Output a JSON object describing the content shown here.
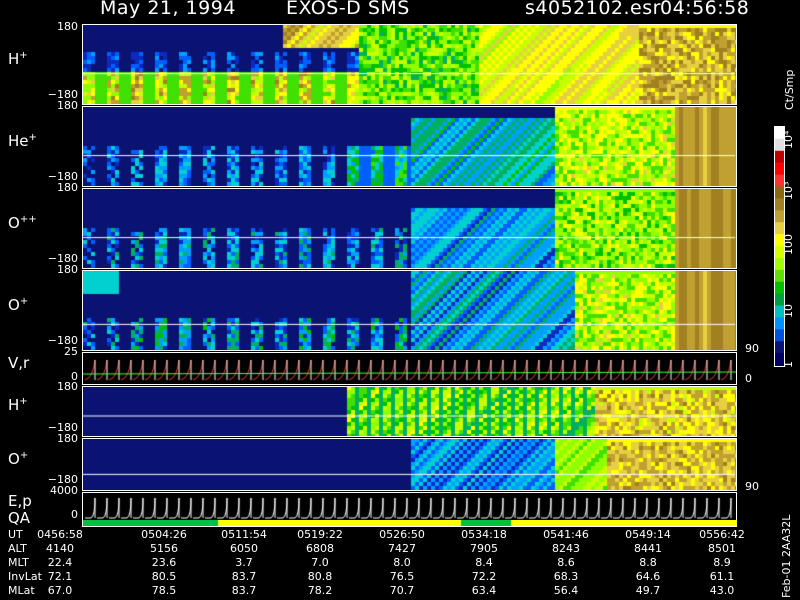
{
  "header": {
    "date": "May 21, 1994",
    "instrument": "EXOS-D SMS",
    "file": "s4052102.esr",
    "time": "04:56:58"
  },
  "panels": [
    {
      "id": "H+",
      "label": "H",
      "sup": "+",
      "ytop": "180",
      "ybot": "−180"
    },
    {
      "id": "He+",
      "label": "He",
      "sup": "+",
      "ytop": "180",
      "ybot": "−180"
    },
    {
      "id": "O++",
      "label": "O",
      "sup": "++",
      "ytop": "180",
      "ybot": "−180"
    },
    {
      "id": "O+",
      "label": "O",
      "sup": "+",
      "ytop": "180",
      "ybot": "−180"
    },
    {
      "id": "Vr",
      "label": "V,r",
      "sup": "",
      "ytop": "25",
      "ybot": "0",
      "rtop": "90",
      "rbot": "0"
    },
    {
      "id": "H+b",
      "label": "H",
      "sup": "+",
      "ytop": "180",
      "ybot": "−180"
    },
    {
      "id": "O+b",
      "label": "O",
      "sup": "+",
      "ytop": "180",
      "ybot": "−180",
      "rbot": "90"
    },
    {
      "id": "Ep",
      "label": "E,p",
      "sup": "",
      "ytop": "4000",
      "ybot": "0"
    }
  ],
  "qa_label": "QA",
  "colorbar": {
    "unit": "Ct/Smp",
    "ticks": [
      "10⁴",
      "10³",
      "100",
      "10",
      "1"
    ],
    "colors": [
      "#ffffff",
      "#e0e0e0",
      "#c00000",
      "#ff0000",
      "#ff3030",
      "#8b6914",
      "#a08020",
      "#c0a030",
      "#e6d040",
      "#ffff00",
      "#d4ff00",
      "#a0ff00",
      "#60e000",
      "#00c000",
      "#00a040",
      "#00c0c0",
      "#0090ff",
      "#0050e0",
      "#0a1372",
      "#000060"
    ]
  },
  "footer_label": "Feb-01 2AA32L",
  "table": {
    "rows": [
      {
        "name": "UT",
        "values": [
          "0456:58",
          "0504:26",
          "0511:54",
          "0519:22",
          "0526:50",
          "0534:18",
          "0541:46",
          "0549:14",
          "0556:42"
        ]
      },
      {
        "name": "ALT",
        "values": [
          "4140",
          "5156",
          "6050",
          "6808",
          "7427",
          "7905",
          "8243",
          "8441",
          "8501"
        ]
      },
      {
        "name": "MLT",
        "values": [
          "22.4",
          "23.6",
          "3.7",
          "7.0",
          "8.0",
          "8.4",
          "8.6",
          "8.8",
          "8.9"
        ]
      },
      {
        "name": "InvLat",
        "values": [
          "72.1",
          "80.5",
          "83.7",
          "80.8",
          "76.5",
          "72.2",
          "68.3",
          "64.6",
          "61.1"
        ]
      },
      {
        "name": "MLat",
        "values": [
          "67.0",
          "78.5",
          "83.7",
          "78.2",
          "70.7",
          "63.4",
          "56.4",
          "49.7",
          "43.0"
        ]
      }
    ]
  },
  "colors": {
    "background": "#000000",
    "panel_bg": "#0a1372",
    "text": "#ffffff"
  }
}
